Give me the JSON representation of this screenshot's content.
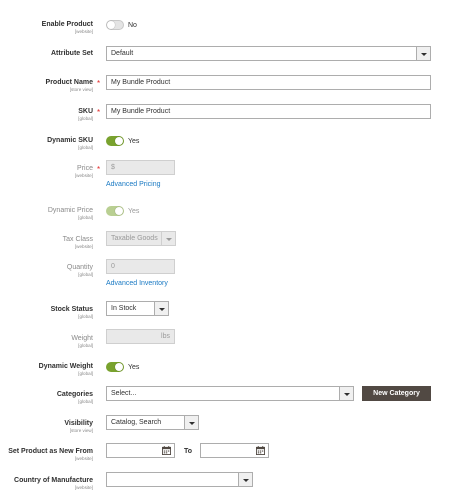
{
  "enable_product": {
    "label": "Enable Product",
    "scope": "[website]",
    "value": "No",
    "on": false
  },
  "attribute_set": {
    "label": "Attribute Set",
    "value": "Default"
  },
  "product_name": {
    "label": "Product Name",
    "scope": "[store view]",
    "value": "My Bundle Product",
    "required": "*"
  },
  "sku": {
    "label": "SKU",
    "scope": "[global]",
    "value": "My Bundle Product",
    "required": "*"
  },
  "dynamic_sku": {
    "label": "Dynamic SKU",
    "scope": "[global]",
    "value": "Yes",
    "on": true
  },
  "price": {
    "label": "Price",
    "scope": "[website]",
    "prefix": "$",
    "required": "*",
    "link": "Advanced Pricing"
  },
  "dynamic_price": {
    "label": "Dynamic Price",
    "scope": "[global]",
    "value": "Yes",
    "on": true,
    "disabled": true
  },
  "tax_class": {
    "label": "Tax Class",
    "scope": "[website]",
    "value": "Taxable Goods"
  },
  "quantity": {
    "label": "Quantity",
    "scope": "[global]",
    "value": "0",
    "link": "Advanced Inventory"
  },
  "stock_status": {
    "label": "Stock Status",
    "scope": "[global]",
    "value": "In Stock"
  },
  "weight": {
    "label": "Weight",
    "scope": "[global]",
    "unit": "lbs"
  },
  "dynamic_weight": {
    "label": "Dynamic Weight",
    "scope": "[global]",
    "value": "Yes",
    "on": true
  },
  "categories": {
    "label": "Categories",
    "scope": "[global]",
    "placeholder": "Select...",
    "button": "New Category"
  },
  "visibility": {
    "label": "Visibility",
    "scope": "[store view]",
    "value": "Catalog, Search"
  },
  "new_from": {
    "label": "Set Product as New From",
    "scope": "[website]",
    "to_label": "To"
  },
  "country": {
    "label": "Country of Manufacture",
    "scope": "[website]",
    "value": ""
  },
  "colors": {
    "accent": "#79a22e",
    "link": "#1979c3",
    "required": "#e22626",
    "button": "#514943"
  }
}
